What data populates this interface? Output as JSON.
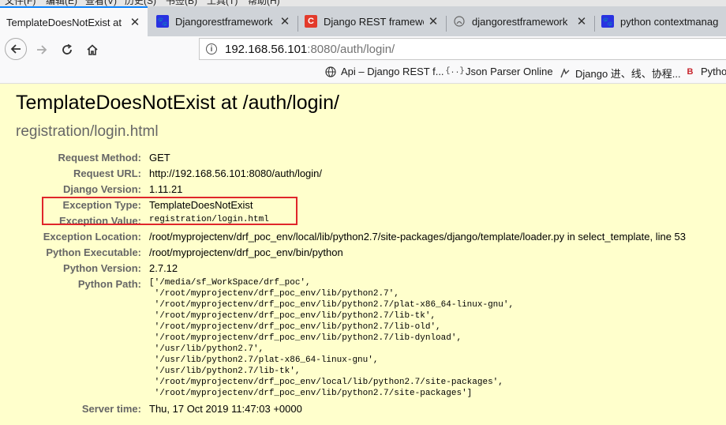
{
  "menu": [
    "文件(F)",
    "编辑(E)",
    "查看(V)",
    "历史(S)",
    "书签(B)",
    "工具(T)",
    "帮助(H)"
  ],
  "tabs": [
    {
      "title": "TemplateDoesNotExist at",
      "icon": "page-icon",
      "active": true
    },
    {
      "title": "Djangorestframework",
      "icon": "paw-icon",
      "active": false
    },
    {
      "title": "Django REST framewo",
      "icon": "csdn-c-icon",
      "active": false
    },
    {
      "title": "djangorestframework",
      "icon": "github-icon",
      "active": false
    },
    {
      "title": "python contextmanag",
      "icon": "paw-icon",
      "active": false
    }
  ],
  "url": {
    "host": "192.168.56.101",
    "rest": ":8080/auth/login/"
  },
  "bookmarks": [
    {
      "label": "Api – Django REST f...",
      "icon": "globe-icon"
    },
    {
      "label": "Json Parser Online",
      "icon": "braces-icon"
    },
    {
      "label": "Django 进、线、协程...",
      "icon": "github-icon"
    },
    {
      "label": "Pytho",
      "icon": "bookmark-b-icon"
    }
  ],
  "page": {
    "title": "TemplateDoesNotExist at /auth/login/",
    "subtitle": "registration/login.html"
  },
  "summary": {
    "request_method": {
      "key": "Request Method:",
      "value": "GET"
    },
    "request_url": {
      "key": "Request URL:",
      "value": "http://192.168.56.101:8080/auth/login/"
    },
    "django_version": {
      "key": "Django Version:",
      "value": "1.11.21"
    },
    "exception_type": {
      "key": "Exception Type:",
      "value": "TemplateDoesNotExist"
    },
    "exception_value": {
      "key": "Exception Value:",
      "value": "registration/login.html"
    },
    "exception_location": {
      "key": "Exception Location:",
      "value": "/root/myprojectenv/drf_poc_env/local/lib/python2.7/site-packages/django/template/loader.py in select_template, line 53"
    },
    "python_executable": {
      "key": "Python Executable:",
      "value": "/root/myprojectenv/drf_poc_env/bin/python"
    },
    "python_version": {
      "key": "Python Version:",
      "value": "2.7.12"
    },
    "python_path": {
      "key": "Python Path:",
      "value": "['/media/sf_WorkSpace/drf_poc',\n '/root/myprojectenv/drf_poc_env/lib/python2.7',\n '/root/myprojectenv/drf_poc_env/lib/python2.7/plat-x86_64-linux-gnu',\n '/root/myprojectenv/drf_poc_env/lib/python2.7/lib-tk',\n '/root/myprojectenv/drf_poc_env/lib/python2.7/lib-old',\n '/root/myprojectenv/drf_poc_env/lib/python2.7/lib-dynload',\n '/usr/lib/python2.7',\n '/usr/lib/python2.7/plat-x86_64-linux-gnu',\n '/usr/lib/python2.7/lib-tk',\n '/root/myprojectenv/drf_poc_env/local/lib/python2.7/site-packages',\n '/root/myprojectenv/drf_poc_env/lib/python2.7/site-packages']"
    },
    "server_time": {
      "key": "Server time:",
      "value": "Thu, 17 Oct 2019 11:47:03 +0000"
    }
  },
  "colors": {
    "tab_accent": "#0a84ff",
    "highlight_box": "#e0262b",
    "page_bg": "#ffffcc"
  }
}
